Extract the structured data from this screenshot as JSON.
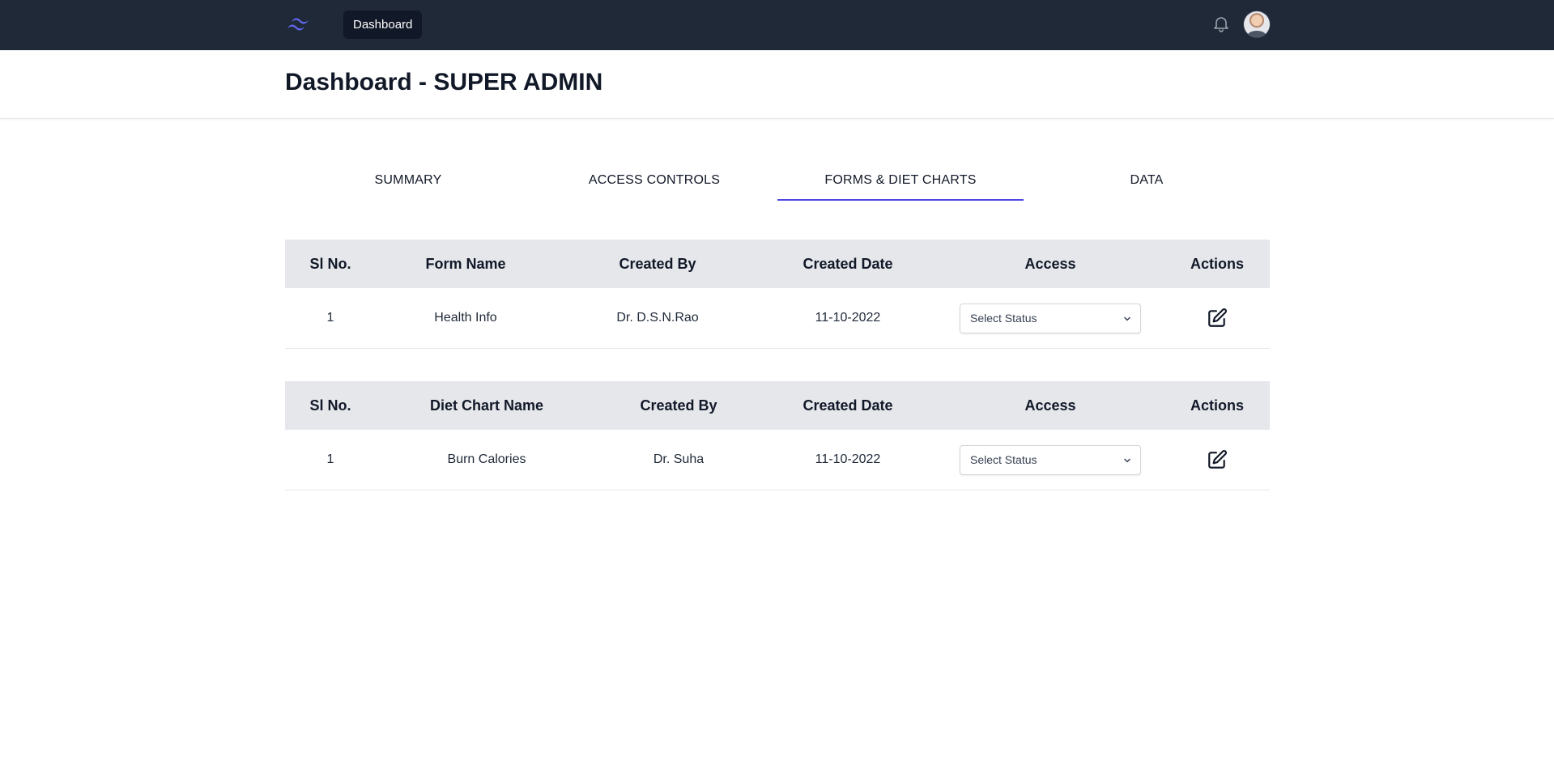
{
  "nav": {
    "logo_icon": "tailwind-logo-icon",
    "dashboard_label": "Dashboard",
    "bell_icon": "bell-icon",
    "accent_color": "#4f46e5"
  },
  "header": {
    "title": "Dashboard - SUPER ADMIN"
  },
  "tabs": [
    {
      "label": "SUMMARY",
      "active": false
    },
    {
      "label": "ACCESS CONTROLS",
      "active": false
    },
    {
      "label": "FORMS & DIET CHARTS",
      "active": true
    },
    {
      "label": "DATA",
      "active": false
    }
  ],
  "forms_table": {
    "headers": [
      "Sl No.",
      "Form Name",
      "Created By",
      "Created Date",
      "Access",
      "Actions"
    ],
    "rows": [
      {
        "sl": "1",
        "name": "Health Info",
        "created_by": "Dr. D.S.N.Rao",
        "created_date": "11-10-2022",
        "access": "Select Status"
      }
    ]
  },
  "diet_table": {
    "headers": [
      "Sl No.",
      "Diet Chart Name",
      "Created By",
      "Created Date",
      "Access",
      "Actions"
    ],
    "rows": [
      {
        "sl": "1",
        "name": "Burn Calories",
        "created_by": "Dr. Suha",
        "created_date": "11-10-2022",
        "access": "Select Status"
      }
    ]
  }
}
